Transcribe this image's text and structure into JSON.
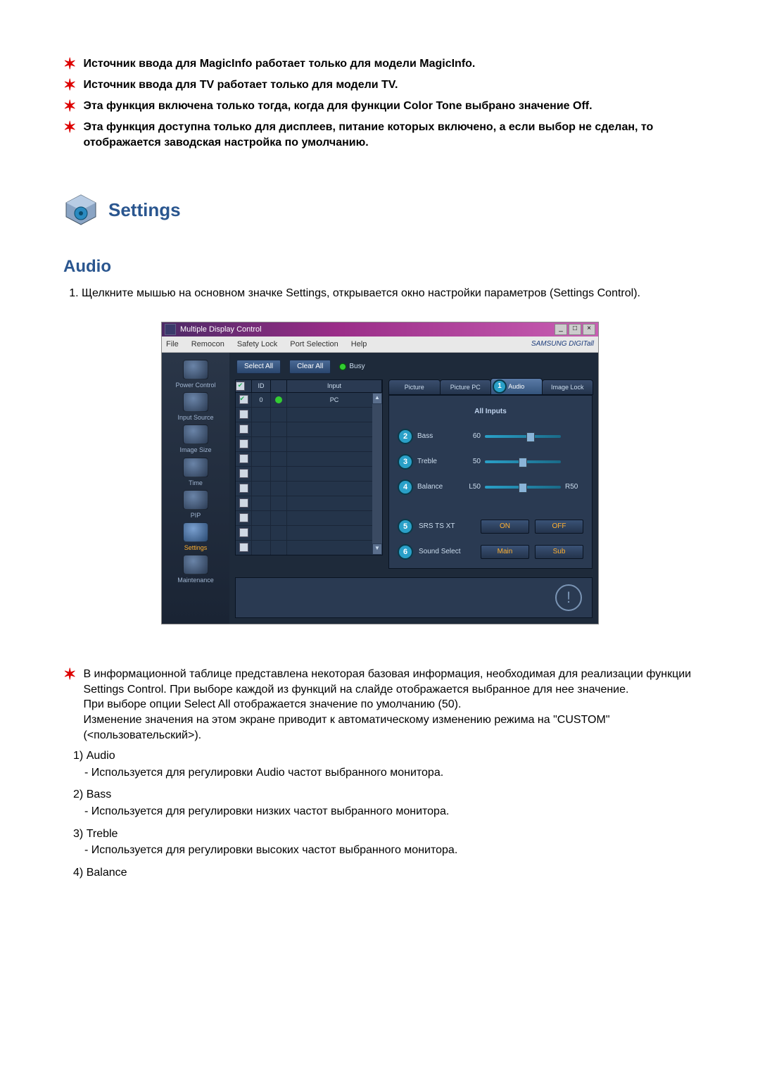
{
  "bullets": [
    "Источник ввода для MagicInfo работает только для модели MagicInfo.",
    "Источник ввода для TV работает только для модели TV.",
    "Эта функция включена только тогда, когда для функции Color Tone выбрано значение Off.",
    "Эта функция доступна только для дисплеев, питание которых включено, а если выбор не сделан, то отображается заводская настройка по умолчанию."
  ],
  "settings_title": "Settings",
  "audio_title": "Audio",
  "audio_step": "Щелкните мышью на основном значке Settings, открывается окно настройки параметров (Settings Control).",
  "win": {
    "title": "Multiple Display Control",
    "menu": {
      "file": "File",
      "remocon": "Remocon",
      "safety": "Safety Lock",
      "port": "Port Selection",
      "help": "Help",
      "brand": "SAMSUNG DIGITall"
    },
    "sidebar": {
      "power": "Power Control",
      "input": "Input Source",
      "image": "Image Size",
      "time": "Time",
      "pip": "PIP",
      "settings": "Settings",
      "maint": "Maintenance"
    },
    "toolbar": {
      "select_all": "Select All",
      "clear_all": "Clear All",
      "busy": "Busy"
    },
    "grid": {
      "h_id": "ID",
      "h_input": "Input",
      "row_id": "0",
      "row_input": "PC"
    },
    "tabs": {
      "picture": "Picture",
      "picture_pc": "Picture PC",
      "audio": "Audio",
      "image_lock": "Image Lock"
    },
    "panel": {
      "all_inputs": "All Inputs",
      "bass_label": "Bass",
      "bass_val": "60",
      "treble_label": "Treble",
      "treble_val": "50",
      "balance_label": "Balance",
      "balance_l": "L50",
      "balance_r": "R50",
      "srs_label": "SRS TS XT",
      "on": "ON",
      "off": "OFF",
      "sound_label": "Sound Select",
      "main": "Main",
      "sub": "Sub"
    },
    "markers": {
      "m1": "1",
      "m2": "2",
      "m3": "3",
      "m4": "4",
      "m5": "5",
      "m6": "6"
    }
  },
  "after_star": "В информационной таблице представлена некоторая базовая информация, необходимая для реализации функции Settings Control. При выборе каждой из функций на слайде отображается выбранное для нее значение.",
  "after_p1": "При выборе опции Select All отображается значение по умолчанию (50).",
  "after_p2": "Изменение значения на этом экране приводит к автоматическому изменению режима на \"CUSTOM\" (<пользовательский>).",
  "items": {
    "i1_t": "Audio",
    "i1_d": "- Используется для регулировки Audio частот выбранного монитора.",
    "i2_t": "Bass",
    "i2_d": "- Используется для регулировки низких частот выбранного монитора.",
    "i3_t": "Treble",
    "i3_d": "- Используется для регулировки высоких частот выбранного монитора.",
    "i4_t": "Balance"
  },
  "num": {
    "n1": "1)",
    "n2": "2)",
    "n3": "3)",
    "n4": "4)"
  }
}
